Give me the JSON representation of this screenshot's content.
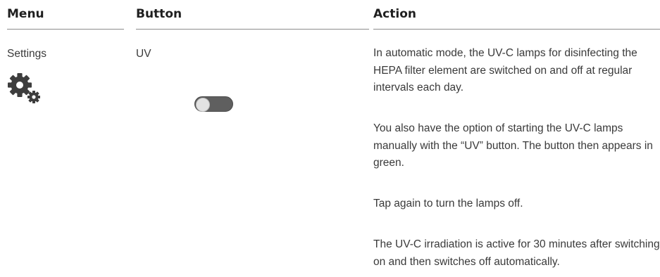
{
  "headers": {
    "menu": "Menu",
    "button": "Button",
    "action": "Action"
  },
  "row": {
    "menu_label": "Settings",
    "menu_icon": "gear-icon",
    "button_label": "UV",
    "toggle_state": "off",
    "paragraphs": [
      "In automatic mode, the UV-C lamps for disinfecting the HEPA filter element are switched on and off at regular intervals each day.",
      "You also have the option of starting the UV-C lamps manually with the “UV” button. The button then appears in green.",
      "Tap again to turn the lamps off.",
      "The UV-C irradiation is active for 30 minutes after switching on and then switches off automatically."
    ]
  },
  "colors": {
    "text": "#3a3a3a",
    "toggle_off": "#5f5f5f",
    "knob": "#e3e3e3"
  }
}
